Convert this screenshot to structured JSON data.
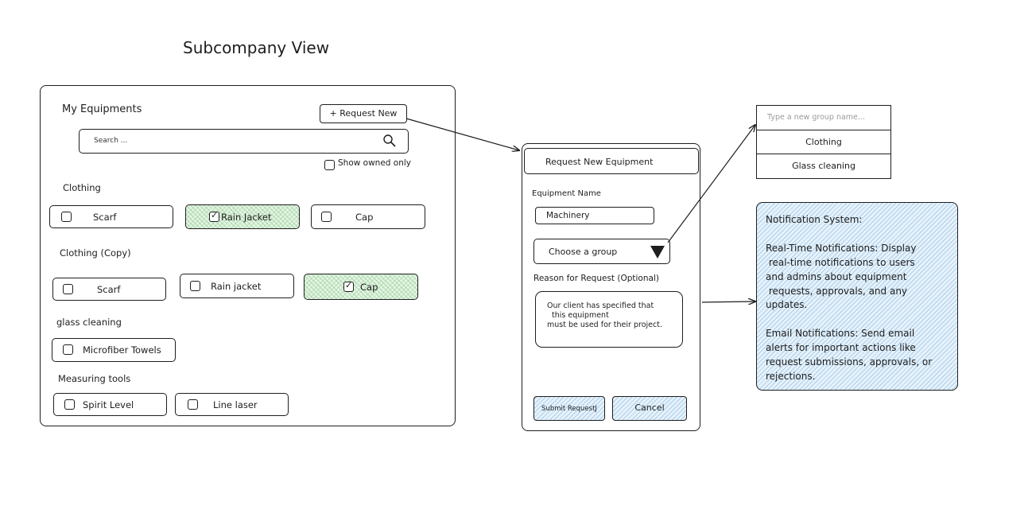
{
  "page": {
    "title": "Subcompany View"
  },
  "equipments": {
    "title": "My Equipments",
    "request_new_label": "+ Request New",
    "search_placeholder": "Search ...",
    "show_owned_label": "Show owned only",
    "groups": [
      {
        "name": "Clothing",
        "items": [
          {
            "label": "Scarf",
            "checked": false
          },
          {
            "label": "Rain Jacket",
            "checked": true
          },
          {
            "label": "Cap",
            "checked": false
          }
        ]
      },
      {
        "name": "Clothing (Copy)",
        "items": [
          {
            "label": "Scarf",
            "checked": false
          },
          {
            "label": "Rain jacket",
            "checked": false
          },
          {
            "label": "Cap",
            "checked": true
          }
        ]
      },
      {
        "name": "glass cleaning",
        "items": [
          {
            "label": "Microfiber Towels",
            "checked": false
          }
        ]
      },
      {
        "name": "Measuring tools",
        "items": [
          {
            "label": "Spirit Level",
            "checked": false
          },
          {
            "label": "Line laser",
            "checked": false
          }
        ]
      }
    ]
  },
  "request_form": {
    "title": "Request New Equipment",
    "name_label": "Equipment Name",
    "name_value": "Machinery",
    "group_select": "Choose a group",
    "reason_label": "Reason for Request (Optional)",
    "reason_value": "Our client has specified that\n  this equipment\nmust be used for their project.",
    "submit_label": "Submit RequestJ",
    "cancel_label": "Cancel"
  },
  "group_dropdown": {
    "placeholder": "Type a new group name...",
    "options": [
      "Clothing",
      "Glass cleaning"
    ]
  },
  "notification_note": {
    "text": "Notification System:\n\nReal-Time Notifications: Display\n real-time notifications to users\nand admins about equipment\n requests, approvals, and any\nupdates.\n\nEmail Notifications: Send email\nalerts for important actions like\nrequest submissions, approvals, or\nrejections."
  },
  "colors": {
    "stroke": "#1e1e1e",
    "checked_fill": "#e4f5e4",
    "note_fill": "#e6f2fb"
  }
}
